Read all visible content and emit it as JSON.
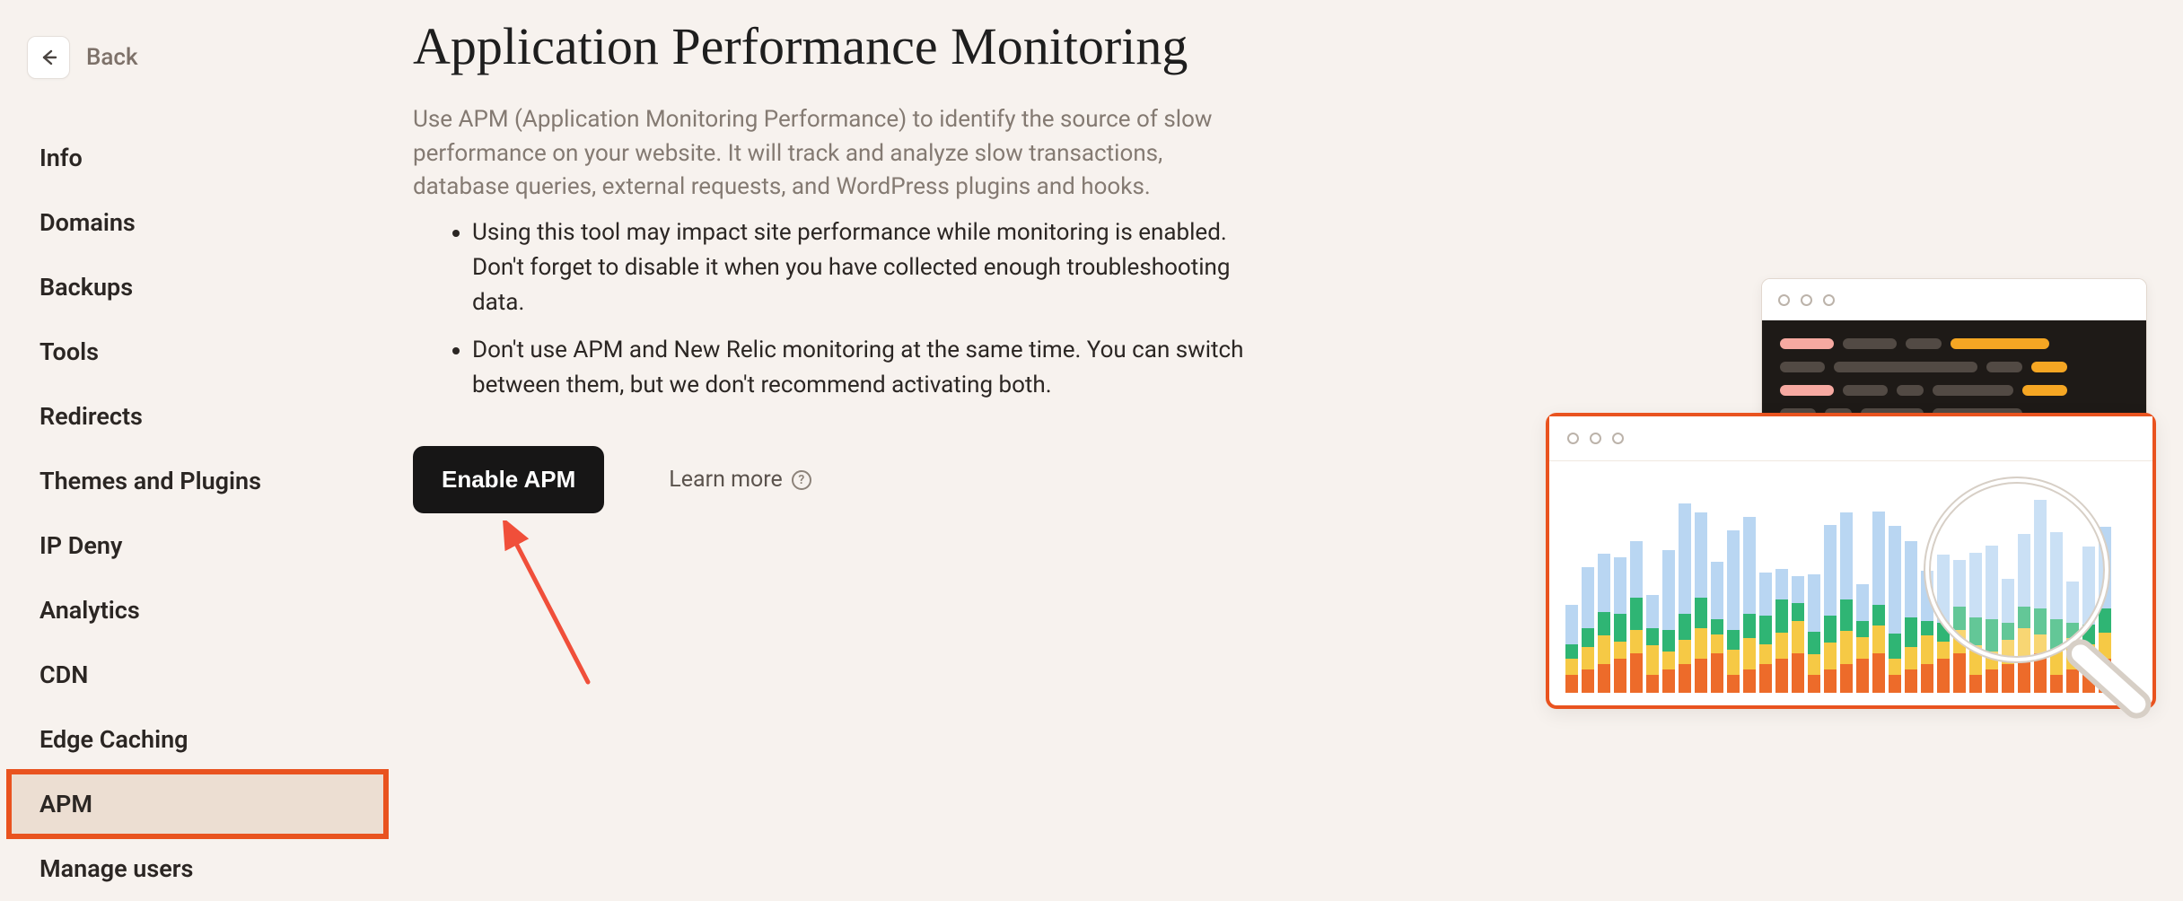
{
  "back": {
    "label": "Back"
  },
  "sidebar": {
    "items": [
      {
        "label": "Info"
      },
      {
        "label": "Domains"
      },
      {
        "label": "Backups"
      },
      {
        "label": "Tools"
      },
      {
        "label": "Redirects"
      },
      {
        "label": "Themes and Plugins"
      },
      {
        "label": "IP Deny"
      },
      {
        "label": "Analytics"
      },
      {
        "label": "CDN"
      },
      {
        "label": "Edge Caching"
      },
      {
        "label": "APM",
        "selected": true
      },
      {
        "label": "Manage users"
      }
    ]
  },
  "main": {
    "title": "Application Performance Monitoring",
    "intro": "Use APM (Application Monitoring Performance) to identify the source of slow performance on your website. It will track and analyze slow transactions, database queries, external requests, and WordPress plugins and hooks.",
    "bullets": [
      "Using this tool may impact site performance while monitoring is enabled. Don't forget to disable it when you have collected enough troubleshooting data.",
      "Don't use APM and New Relic monitoring at the same time. You can switch between them, but we don't recommend activating both."
    ],
    "enable_label": "Enable APM",
    "learn_more_label": "Learn more"
  }
}
